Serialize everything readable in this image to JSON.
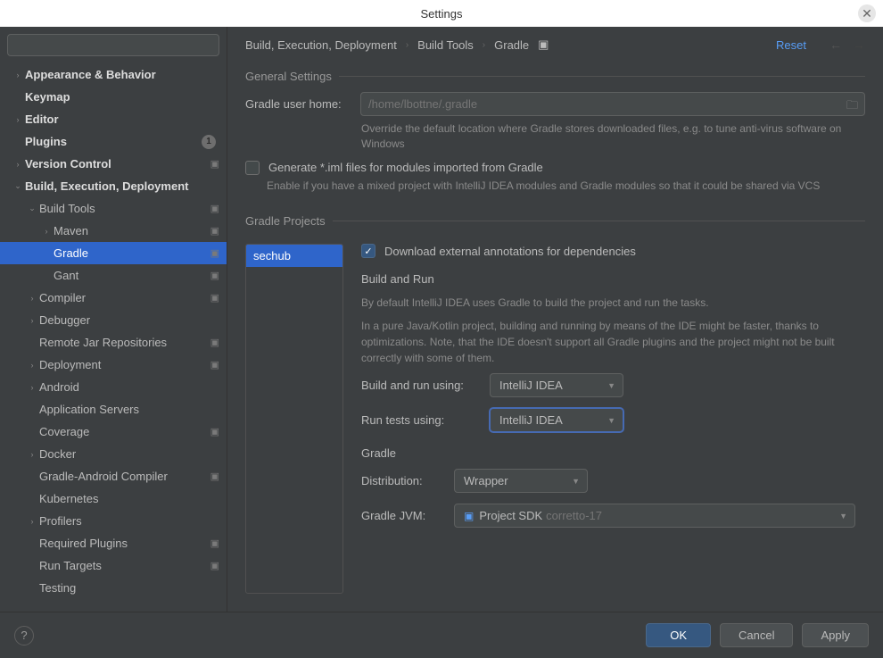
{
  "window": {
    "title": "Settings"
  },
  "search": {
    "placeholder": ""
  },
  "sidebar": {
    "items": [
      {
        "label": "Appearance & Behavior",
        "indent": 0,
        "arrow": "right",
        "bold": true,
        "proj": false
      },
      {
        "label": "Keymap",
        "indent": 0,
        "arrow": "",
        "bold": true,
        "proj": false
      },
      {
        "label": "Editor",
        "indent": 0,
        "arrow": "right",
        "bold": true,
        "proj": false
      },
      {
        "label": "Plugins",
        "indent": 0,
        "arrow": "",
        "bold": true,
        "badge": "1",
        "proj": false
      },
      {
        "label": "Version Control",
        "indent": 0,
        "arrow": "right",
        "bold": true,
        "proj": true
      },
      {
        "label": "Build, Execution, Deployment",
        "indent": 0,
        "arrow": "down",
        "bold": true,
        "proj": false
      },
      {
        "label": "Build Tools",
        "indent": 1,
        "arrow": "down",
        "bold": false,
        "proj": true
      },
      {
        "label": "Maven",
        "indent": 2,
        "arrow": "right",
        "bold": false,
        "proj": true
      },
      {
        "label": "Gradle",
        "indent": 2,
        "arrow": "",
        "bold": false,
        "selected": true,
        "proj": true
      },
      {
        "label": "Gant",
        "indent": 2,
        "arrow": "",
        "bold": false,
        "proj": true
      },
      {
        "label": "Compiler",
        "indent": 1,
        "arrow": "right",
        "bold": false,
        "proj": true
      },
      {
        "label": "Debugger",
        "indent": 1,
        "arrow": "right",
        "bold": false,
        "proj": false
      },
      {
        "label": "Remote Jar Repositories",
        "indent": 1,
        "arrow": "",
        "bold": false,
        "proj": true
      },
      {
        "label": "Deployment",
        "indent": 1,
        "arrow": "right",
        "bold": false,
        "proj": true
      },
      {
        "label": "Android",
        "indent": 1,
        "arrow": "right",
        "bold": false,
        "proj": false
      },
      {
        "label": "Application Servers",
        "indent": 1,
        "arrow": "",
        "bold": false,
        "proj": false
      },
      {
        "label": "Coverage",
        "indent": 1,
        "arrow": "",
        "bold": false,
        "proj": true
      },
      {
        "label": "Docker",
        "indent": 1,
        "arrow": "right",
        "bold": false,
        "proj": false
      },
      {
        "label": "Gradle-Android Compiler",
        "indent": 1,
        "arrow": "",
        "bold": false,
        "proj": true
      },
      {
        "label": "Kubernetes",
        "indent": 1,
        "arrow": "",
        "bold": false,
        "proj": false
      },
      {
        "label": "Profilers",
        "indent": 1,
        "arrow": "right",
        "bold": false,
        "proj": false
      },
      {
        "label": "Required Plugins",
        "indent": 1,
        "arrow": "",
        "bold": false,
        "proj": true
      },
      {
        "label": "Run Targets",
        "indent": 1,
        "arrow": "",
        "bold": false,
        "proj": true
      },
      {
        "label": "Testing",
        "indent": 1,
        "arrow": "",
        "bold": false,
        "proj": false
      }
    ]
  },
  "breadcrumb": {
    "crumbs": [
      "Build, Execution, Deployment",
      "Build Tools",
      "Gradle"
    ],
    "reset": "Reset"
  },
  "general": {
    "legend": "General Settings",
    "home_label": "Gradle user home:",
    "home_placeholder": "/home/lbottne/.gradle",
    "home_hint": "Override the default location where Gradle stores downloaded files, e.g. to tune anti-virus software on Windows",
    "iml_label": "Generate *.iml files for modules imported from Gradle",
    "iml_hint": "Enable if you have a mixed project with IntelliJ IDEA modules and Gradle modules so that it could be shared via VCS"
  },
  "projects": {
    "legend": "Gradle Projects",
    "items": [
      "sechub"
    ],
    "download_label": "Download external annotations for dependencies",
    "build_run": {
      "title": "Build and Run",
      "p1": "By default IntelliJ IDEA uses Gradle to build the project and run the tasks.",
      "p2": "In a pure Java/Kotlin project, building and running by means of the IDE might be faster, thanks to optimizations. Note, that the IDE doesn't support all Gradle plugins and the project might not be built correctly with some of them.",
      "build_label": "Build and run using:",
      "build_value": "IntelliJ IDEA",
      "tests_label": "Run tests using:",
      "tests_value": "IntelliJ IDEA"
    },
    "gradle": {
      "title": "Gradle",
      "dist_label": "Distribution:",
      "dist_value": "Wrapper",
      "jvm_label": "Gradle JVM:",
      "jvm_value": "Project SDK",
      "jvm_detail": "corretto-17"
    }
  },
  "footer": {
    "ok": "OK",
    "cancel": "Cancel",
    "apply": "Apply"
  }
}
